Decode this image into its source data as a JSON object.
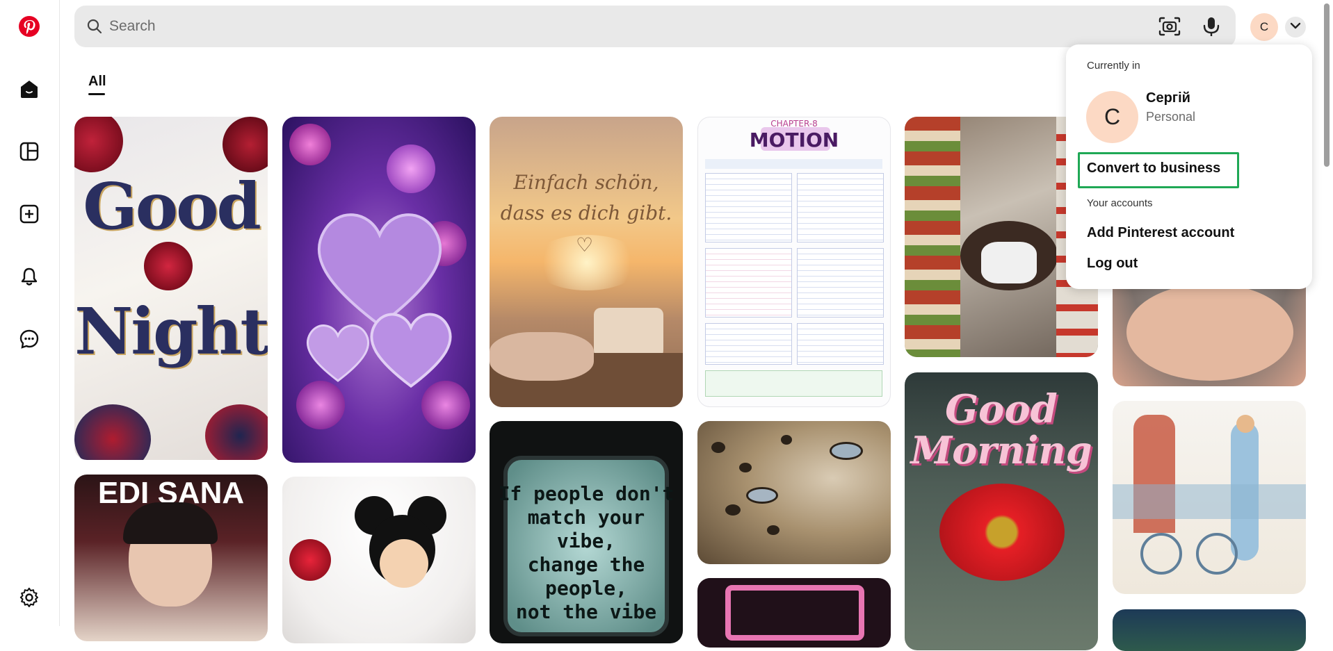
{
  "search": {
    "placeholder": "Search"
  },
  "user": {
    "initial": "C",
    "name": "Сергій",
    "type": "Personal"
  },
  "tabs": [
    {
      "label": "All"
    }
  ],
  "account_menu": {
    "currently_in_label": "Currently in",
    "convert_label": "Convert to business",
    "your_accounts_label": "Your accounts",
    "add_account_label": "Add Pinterest account",
    "logout_label": "Log out"
  },
  "pins": {
    "good_night": {
      "line1": "Good",
      "line2": "Night"
    },
    "einfach": {
      "line1": "Einfach schön,",
      "line2": "dass es dich gibt."
    },
    "motion": {
      "chapter": "CHAPTER-8",
      "title": "MOTION"
    },
    "edi_sana": {
      "text": "EDI SANA"
    },
    "vibe": {
      "line1": "If people don't",
      "line2": "match your",
      "line3": "vibe,",
      "line4": "change the",
      "line5": "people,",
      "line6": "not the vibe"
    },
    "good_morning": {
      "line1": "Good",
      "line2": "Morning"
    }
  },
  "colors": {
    "brand": "#e60023",
    "highlight": "#1fa855",
    "avatar_bg": "#fcd9c4"
  }
}
